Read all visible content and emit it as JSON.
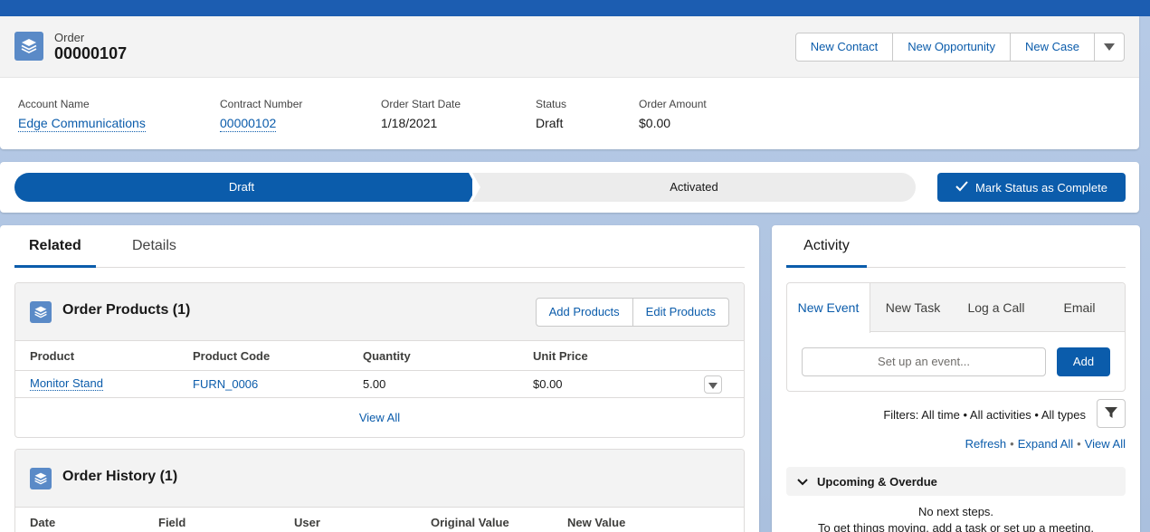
{
  "colors": {
    "brand": "#0b5cab",
    "header_band": "#1c5db1",
    "icon_bg": "#5a8ac7"
  },
  "highlights": {
    "icon": "order-icon",
    "object_label": "Order",
    "record_title": "00000107",
    "actions": [
      "New Contact",
      "New Opportunity",
      "New Case"
    ],
    "more_actions_icon": "chevron-down-icon",
    "fields": [
      {
        "label": "Account Name",
        "value": "Edge Communications",
        "link": true
      },
      {
        "label": "Contract Number",
        "value": "00000102",
        "link": true
      },
      {
        "label": "Order Start Date",
        "value": "1/18/2021",
        "link": false
      },
      {
        "label": "Status",
        "value": "Draft",
        "link": false
      },
      {
        "label": "Order Amount",
        "value": "$0.00",
        "link": false
      }
    ]
  },
  "path": {
    "stages": [
      "Draft",
      "Activated"
    ],
    "current_stage": "Draft",
    "mark_complete_label": "Mark Status as Complete"
  },
  "left": {
    "tabs": [
      "Related",
      "Details"
    ],
    "active_tab": "Related",
    "order_products": {
      "title": "Order Products (1)",
      "buttons": [
        "Add Products",
        "Edit Products"
      ],
      "columns": [
        "Product",
        "Product Code",
        "Quantity",
        "Unit Price"
      ],
      "rows": [
        [
          "Monitor Stand",
          "FURN_0006",
          "5.00",
          "$0.00"
        ]
      ],
      "view_all": "View All"
    },
    "order_history": {
      "title": "Order History (1)",
      "columns": [
        "Date",
        "Field",
        "User",
        "Original Value",
        "New Value"
      ]
    }
  },
  "activity": {
    "tab": "Activity",
    "composer_tabs": [
      "New Event",
      "New Task",
      "Log a Call",
      "Email"
    ],
    "active_composer_tab": "New Event",
    "event_placeholder": "Set up an event...",
    "add_label": "Add",
    "filters_text": "Filters: All time • All activities • All types",
    "links": [
      "Refresh",
      "Expand All",
      "View All"
    ],
    "upcoming_label": "Upcoming & Overdue",
    "no_steps": "No next steps.",
    "no_steps_hint": "To get things moving, add a task or set up a meeting."
  }
}
